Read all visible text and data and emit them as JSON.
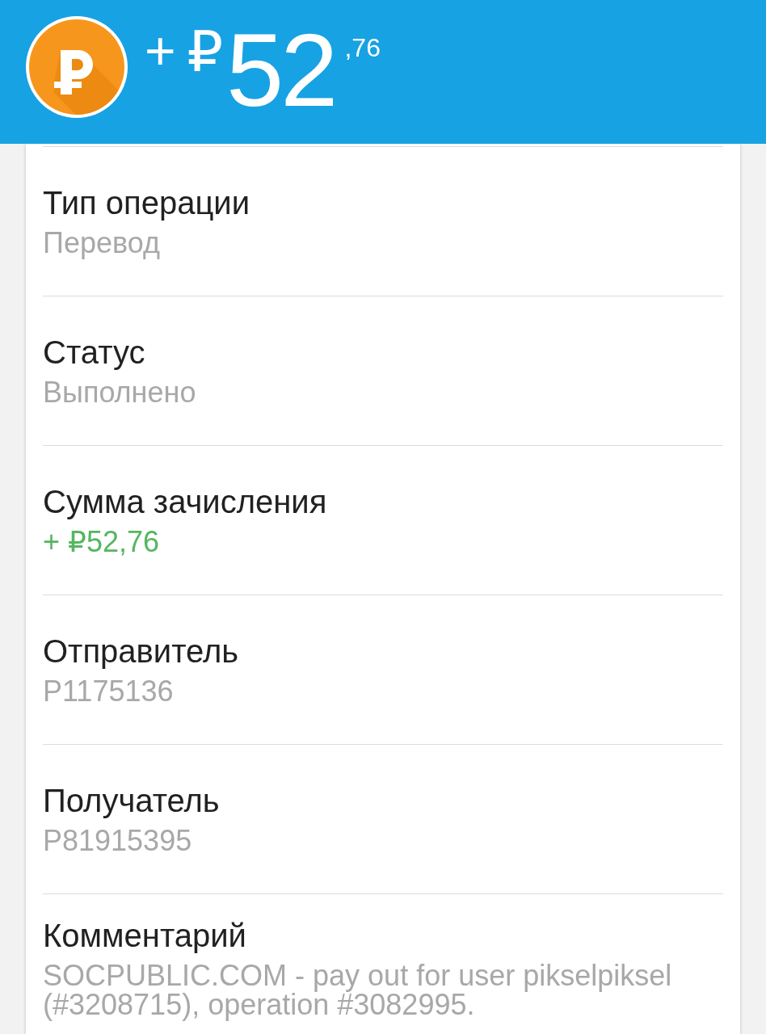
{
  "header": {
    "sign": "+",
    "currency": "₽",
    "whole": "52",
    "fraction": ",76"
  },
  "fields": [
    {
      "label": "Тип операции",
      "value": "Перевод",
      "kind": "plain"
    },
    {
      "label": "Статус",
      "value": "Выполнено",
      "kind": "plain"
    },
    {
      "label": "Сумма зачисления",
      "value": "+ ₽52,76",
      "kind": "credit"
    },
    {
      "label": "Отправитель",
      "value": "P1175136",
      "kind": "plain"
    },
    {
      "label": "Получатель",
      "value": "P81915395",
      "kind": "plain"
    },
    {
      "label": "Комментарий",
      "value": "SOCPUBLIC.COM - pay out for user pikselpiksel (#3208715), operation #3082995.",
      "kind": "plain"
    }
  ]
}
